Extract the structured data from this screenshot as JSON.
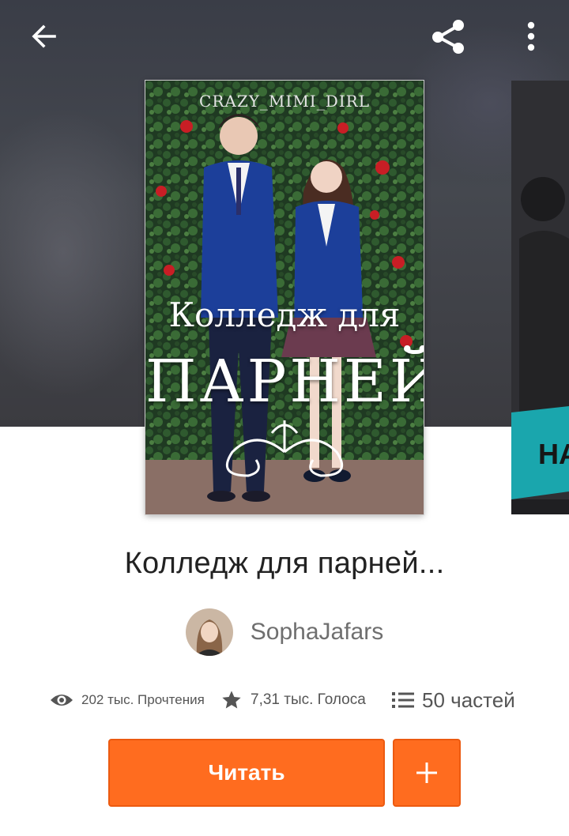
{
  "header": {
    "back_icon": "arrow-left-icon",
    "share_icon": "share-icon",
    "more_icon": "more-vertical-icon"
  },
  "cover": {
    "watermark": "CRAZY_MIMI_DIRL",
    "title_line1": "Колледж для",
    "title_line2": "ПАРНЕЙ",
    "next_cover_text": "НА"
  },
  "story": {
    "title": "Колледж для парней...",
    "author": "SophaJafars"
  },
  "stats": {
    "reads": "202 тыс. Прочтения",
    "votes": "7,31 тыс. Голоса",
    "parts": "50 частей"
  },
  "actions": {
    "read_label": "Читать",
    "add_label": "+"
  },
  "colors": {
    "accent": "#ff6c1f",
    "title_text": "#222222",
    "meta_text": "#555555"
  }
}
